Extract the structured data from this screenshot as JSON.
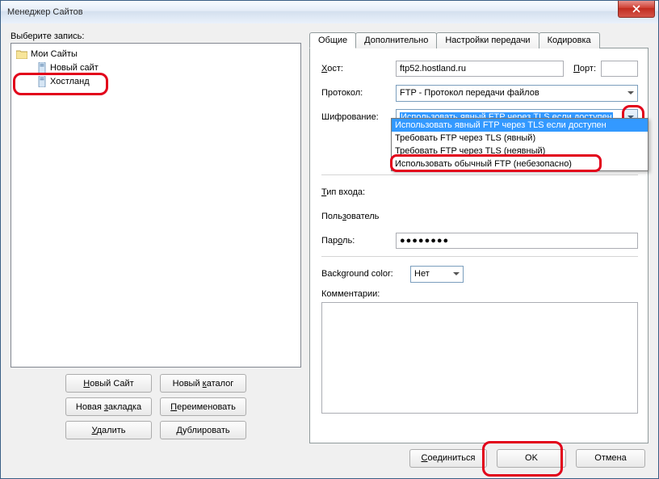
{
  "window": {
    "title": "Менеджер Сайтов"
  },
  "left": {
    "select_label": "Выберите запись:",
    "root": "Мои Сайты",
    "items": [
      "Новый сайт",
      "Хостланд"
    ],
    "buttons": {
      "new_site": "Новый Сайт",
      "new_folder": "Новый каталог",
      "new_bookmark": "Новая закладка",
      "rename": "Переименовать",
      "delete": "Удалить",
      "duplicate": "Дублировать"
    }
  },
  "tabs": {
    "general": "Общие",
    "advanced": "Дополнительно",
    "transfer": "Настройки передачи",
    "charset": "Кодировка"
  },
  "form": {
    "host_label": "Хост:",
    "host_value": "ftp52.hostland.ru",
    "port_label": "Порт:",
    "port_value": "",
    "protocol_label": "Протокол:",
    "protocol_value": "FTP - Протокол передачи файлов",
    "encryption_label": "Шифрование:",
    "encryption_value": "Использовать явный FTP через TLS если доступен",
    "encryption_options": [
      "Использовать явный FTP через TLS если доступен",
      "Требовать FTP через TLS (явный)",
      "Требовать FTP через TLS (неявный)",
      "Использовать обычный FTP (небезопасно)"
    ],
    "logon_label": "Тип входа:",
    "user_label": "Пользователь",
    "password_label": "Пароль:",
    "password_value": "●●●●●●●●",
    "bg_label": "Background color:",
    "bg_value": "Нет",
    "comments_label": "Комментарии:"
  },
  "bottom": {
    "connect": "Соединиться",
    "ok": "OK",
    "cancel": "Отмена"
  },
  "colors": {
    "highlight": "#e2001a",
    "selection": "#3399ff"
  }
}
